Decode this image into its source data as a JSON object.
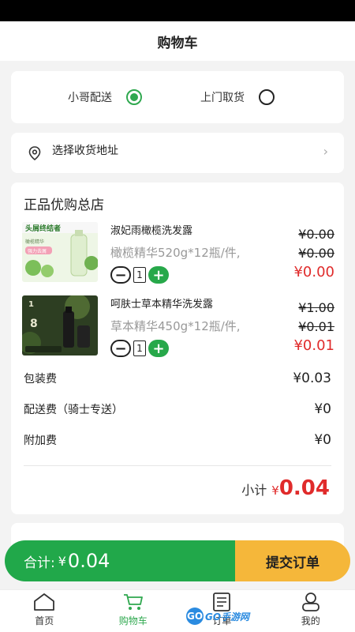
{
  "header": {
    "title": "购物车"
  },
  "delivery": {
    "options": [
      {
        "label": "小哥配送",
        "selected": true
      },
      {
        "label": "上门取货",
        "selected": false
      }
    ]
  },
  "address": {
    "label": "选择收货地址"
  },
  "store": {
    "name": "正品优购总店",
    "products": [
      {
        "name": "淑妃雨橄榄洗发露",
        "spec": "橄榄精华520g*12瓶/件,",
        "qty": "1",
        "price_original": "¥0.00",
        "price_member": "¥0.00",
        "price_final": "¥0.00",
        "thumb_texts": [
          "头屑终结者",
          "橄榄精华",
          "强力去屑"
        ]
      },
      {
        "name": "呵肤士草本精华洗发露",
        "spec": "草本精华450g*12瓶/件,",
        "qty": "1",
        "price_original": "¥1.00",
        "price_member": "¥0.01",
        "price_final": "¥0.01",
        "thumb_texts": [
          "1",
          "8"
        ]
      }
    ],
    "fees": [
      {
        "label": "包装费",
        "value": "¥0.03"
      },
      {
        "label": "配送费（骑士专送）",
        "value": "¥0"
      },
      {
        "label": "附加费",
        "value": "¥0"
      }
    ],
    "subtotal": {
      "label": "小计",
      "currency": "¥",
      "amount": "0.04"
    }
  },
  "checkout": {
    "total_label": "合计:",
    "currency": "¥",
    "amount": "0.04",
    "submit_label": "提交订单"
  },
  "tabbar": {
    "tabs": [
      {
        "label": "首页",
        "icon": "home-icon",
        "active": false
      },
      {
        "label": "购物车",
        "icon": "cart-icon",
        "active": true
      },
      {
        "label": "订单",
        "icon": "order-icon",
        "active": false
      },
      {
        "label": "我的",
        "icon": "profile-icon",
        "active": false
      }
    ]
  },
  "watermark": {
    "logo": "GO",
    "text": "GO手游网"
  },
  "colors": {
    "accent": "#21a84a",
    "price": "#e02b2b",
    "submit": "#f5b73a"
  }
}
